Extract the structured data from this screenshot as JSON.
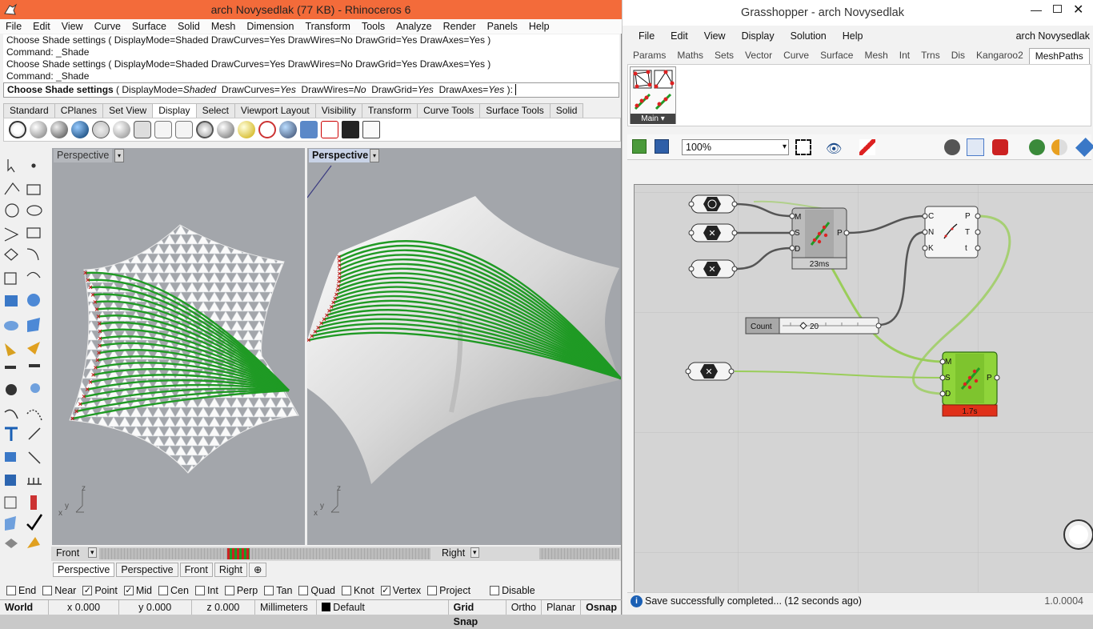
{
  "rhino": {
    "title": "arch Novysedlak (77 KB) - Rhinoceros 6",
    "menu": [
      "File",
      "Edit",
      "View",
      "Curve",
      "Surface",
      "Solid",
      "Mesh",
      "Dimension",
      "Transform",
      "Tools",
      "Analyze",
      "Render",
      "Panels",
      "Help"
    ],
    "history": [
      "Choose Shade settings ( DisplayMode=Shaded  DrawCurves=Yes  DrawWires=No  DrawGrid=Yes  DrawAxes=Yes )",
      "Command: _Shade",
      "Choose Shade settings ( DisplayMode=Shaded  DrawCurves=Yes  DrawWires=No  DrawGrid=Yes  DrawAxes=Yes )",
      "Command: _Shade"
    ],
    "prompt": {
      "label": "Choose Shade settings",
      "open": "(",
      "k1": "DisplayMode=",
      "v1": "Shaded",
      "k2": "DrawCurves=",
      "v2": "Yes",
      "k3": "DrawWires=",
      "v3": "No",
      "k4": "DrawGrid=",
      "v4": "Yes",
      "k5": "DrawAxes=",
      "v5": "Yes",
      "close": "):"
    },
    "tool_tabs": [
      "Standard",
      "CPlanes",
      "Set View",
      "Display",
      "Select",
      "Viewport Layout",
      "Visibility",
      "Transform",
      "Curve Tools",
      "Surface Tools",
      "Solid"
    ],
    "active_tool_tab": "Display",
    "viewports": {
      "left": "Perspective",
      "right": "Perspective",
      "mini_left": "Front",
      "mini_right": "Right"
    },
    "view_tabs": [
      "Perspective",
      "Perspective",
      "Front",
      "Right"
    ],
    "osnap": [
      {
        "label": "End",
        "checked": false
      },
      {
        "label": "Near",
        "checked": false
      },
      {
        "label": "Point",
        "checked": true
      },
      {
        "label": "Mid",
        "checked": true
      },
      {
        "label": "Cen",
        "checked": false
      },
      {
        "label": "Int",
        "checked": false
      },
      {
        "label": "Perp",
        "checked": false
      },
      {
        "label": "Tan",
        "checked": false
      },
      {
        "label": "Quad",
        "checked": false
      },
      {
        "label": "Knot",
        "checked": false
      },
      {
        "label": "Vertex",
        "checked": true
      },
      {
        "label": "Project",
        "checked": false
      },
      {
        "label": "Disable",
        "checked": false
      }
    ],
    "status": {
      "cplane": "World",
      "x": "x 0.000",
      "y": "y 0.000",
      "z": "z 0.000",
      "units": "Millimeters",
      "layer": "Default",
      "grid_snap": "Grid Snap",
      "ortho": "Ortho",
      "planar": "Planar",
      "osnap": "Osnap"
    },
    "axis": {
      "x": "x",
      "y": "y",
      "z": "z"
    }
  },
  "gh": {
    "title": "Grasshopper - arch Novysedlak",
    "menu": [
      "File",
      "Edit",
      "View",
      "Display",
      "Solution",
      "Help"
    ],
    "doc_name": "arch Novysedlak",
    "tabs": [
      "Params",
      "Maths",
      "Sets",
      "Vector",
      "Curve",
      "Surface",
      "Mesh",
      "Int",
      "Trns",
      "Dis",
      "Kangaroo2",
      "MeshPaths"
    ],
    "active_tab": "MeshPaths",
    "ribbon_group": "Main",
    "zoom": "100%",
    "components": {
      "c1": {
        "in": [
          "M",
          "S",
          "D"
        ],
        "out": "P",
        "time": "23ms"
      },
      "c2": {
        "in": [
          "C",
          "N",
          "K"
        ],
        "out": [
          "P",
          "T",
          "t"
        ]
      },
      "c3": {
        "in": [
          "M",
          "S",
          "D"
        ],
        "out": "P",
        "time": "1.7s"
      },
      "slider": {
        "label": "Count",
        "value": "20"
      }
    },
    "status_text": "Save successfully completed... (12 seconds ago)",
    "version": "1.0.0004"
  }
}
